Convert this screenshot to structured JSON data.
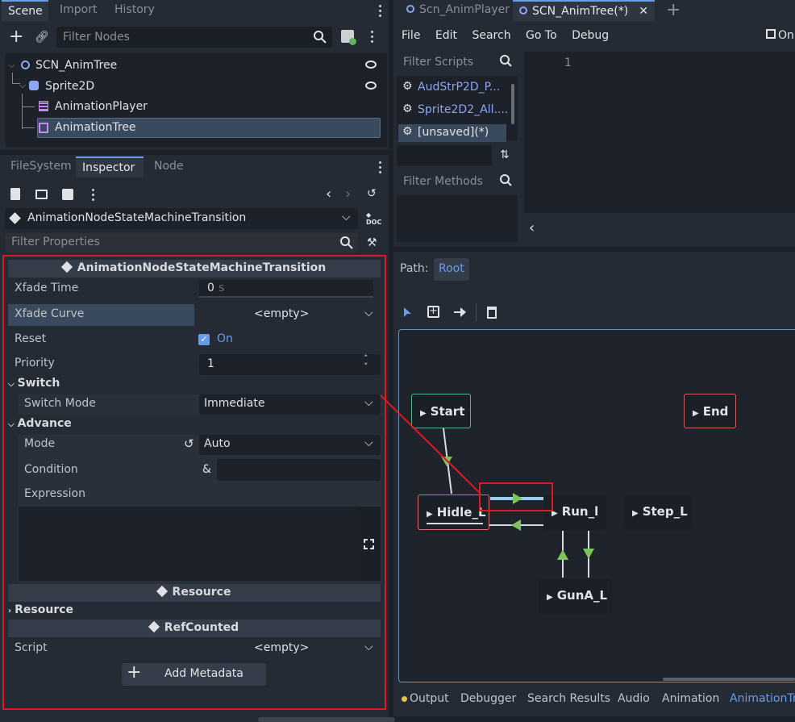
{
  "scene_dock": {
    "tabs": [
      "Scene",
      "Import",
      "History"
    ],
    "filter_placeholder": "Filter Nodes",
    "tree": [
      {
        "label": "SCN_AnimTree"
      },
      {
        "label": "Sprite2D"
      },
      {
        "label": "AnimationPlayer"
      },
      {
        "label": "AnimationTree"
      }
    ]
  },
  "inspector_dock": {
    "tabs": [
      "FileSystem",
      "Inspector",
      "Node"
    ],
    "object_class": "AnimationNodeStateMachineTransition",
    "filter_placeholder": "Filter Properties",
    "section_title": "AnimationNodeStateMachineTransition",
    "properties": {
      "xfade_time_label": "Xfade Time",
      "xfade_time_value": "0",
      "xfade_time_unit": "s",
      "xfade_curve_label": "Xfade Curve",
      "xfade_curve_value": "<empty>",
      "reset_label": "Reset",
      "reset_value": "On",
      "priority_label": "Priority",
      "priority_value": "1"
    },
    "switch_group": {
      "title": "Switch",
      "switch_mode_label": "Switch Mode",
      "switch_mode_value": "Immediate"
    },
    "advance_group": {
      "title": "Advance",
      "mode_label": "Mode",
      "mode_value": "Auto",
      "condition_label": "Condition",
      "condition_prefix": "&",
      "expression_label": "Expression"
    },
    "resource_section_title": "Resource",
    "resource_group_title": "Resource",
    "refcounted_section_title": "RefCounted",
    "script_label": "Script",
    "script_value": "<empty>",
    "add_metadata_label": "Add Metadata"
  },
  "script_editor": {
    "tabs": [
      "Scn_AnimPlayer",
      "SCN_AnimTree(*)"
    ],
    "menu": [
      "File",
      "Edit",
      "Search",
      "Go To",
      "Debug"
    ],
    "menu_right": "On",
    "filter_scripts_placeholder": "Filter Scripts",
    "scripts": [
      "AudStrP2D_P...",
      "Sprite2D2_All....",
      "[unsaved](*)"
    ],
    "filter_methods_placeholder": "Filter Methods",
    "line_number": "1"
  },
  "state_machine": {
    "path_label": "Path:",
    "path_value": "Root",
    "nodes": {
      "start": "Start",
      "end": "End",
      "hidle": "Hidle_L",
      "run": "Run_l",
      "step": "Step_L",
      "guna": "GunA_L"
    }
  },
  "bottom_panel": {
    "tabs": [
      "Output",
      "Debugger",
      "Search Results",
      "Audio",
      "Animation",
      "AnimationTr"
    ]
  },
  "colors": {
    "accent": "#699ce8",
    "highlight_red": "#e0181f",
    "transition_green": "#7ec25b",
    "selected_row": "#3a4a5e"
  }
}
